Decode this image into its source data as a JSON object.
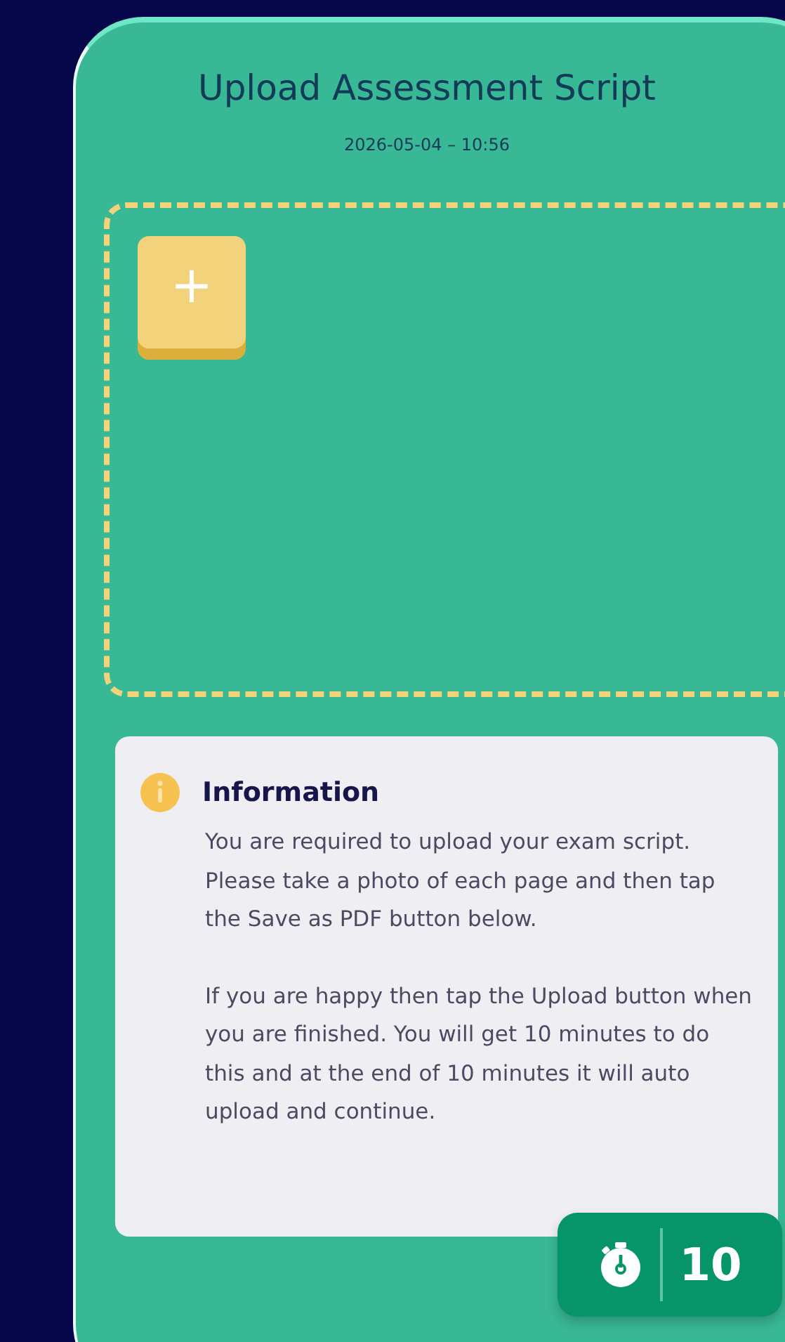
{
  "header": {
    "title": "Upload Assessment Script",
    "timestamp": "2026-05-04 – 10:56"
  },
  "dropzone": {
    "add_button": "+"
  },
  "info": {
    "title": "Information",
    "paragraphs": [
      "You are required to upload your exam script. Please take a photo of each page and then tap the Save as PDF button below.",
      "If you are happy then tap the Upload button when you are finished. You will get 10 minutes to do this and at the end of 10 minutes it will auto upload and continue."
    ]
  },
  "timer": {
    "value": "10"
  }
}
